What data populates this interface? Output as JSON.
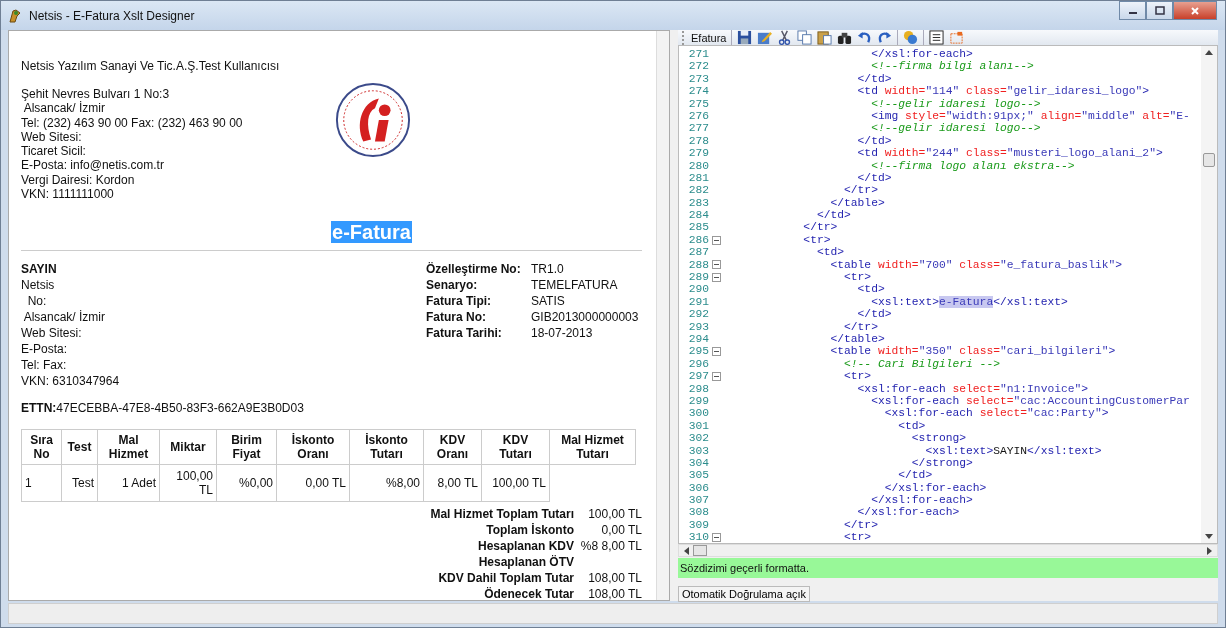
{
  "window": {
    "title": "Netsis - E-Fatura Xslt Designer"
  },
  "invoice": {
    "company_name": "Netsis Yazılım Sanayi Ve Tic.A.Ş.Test Kullanıcısı",
    "company_lines": [
      "Şehit Nevres Bulvarı 1 No:3",
      " Alsancak/ İzmir",
      "Tel: (232) 463 90 00 Fax: (232) 463 90 00",
      "Web Sitesi:",
      "Ticaret Sicil:",
      "E-Posta: info@netis.com.tr",
      "Vergi Dairesi: Kordon",
      "VKN: 1111111000"
    ],
    "title": {
      "text": "e-Fatura",
      "selected": true
    },
    "customer": {
      "heading": "SAYIN",
      "lines": [
        "Netsis",
        "  No:",
        " Alsancak/ İzmir",
        "Web Sitesi:",
        "E-Posta:",
        "Tel: Fax:",
        "VKN: 6310347964"
      ]
    },
    "details": [
      {
        "label": "Özelleştirme No:",
        "value": "TR1.0"
      },
      {
        "label": "Senaryo:",
        "value": "TEMELFATURA"
      },
      {
        "label": "Fatura Tipi:",
        "value": "SATIS"
      },
      {
        "label": "Fatura No:",
        "value": "GIB2013000000003"
      },
      {
        "label": "Fatura Tarihi:",
        "value": "18-07-2013"
      }
    ],
    "ettn": {
      "label": "ETTN:",
      "value": "47ECEBBA-47E8-4B50-83F3-662A9E3B0D03"
    },
    "table": {
      "columns": [
        "Sıra No",
        "Test",
        "Mal Hizmet",
        "Miktar",
        "Birim Fiyat",
        "İskonto Oranı",
        "İskonto Tutarı",
        "KDV Oranı",
        "KDV Tutarı",
        "Mal Hizmet Tutarı"
      ],
      "rows": [
        [
          "1",
          "Test",
          "1 Adet",
          "100,00 TL",
          "%0,00",
          "0,00 TL",
          "%8,00",
          "8,00 TL",
          "100,00 TL"
        ]
      ]
    },
    "totals": [
      {
        "label": "Mal Hizmet Toplam Tutarı",
        "value": "100,00 TL"
      },
      {
        "label": "Toplam İskonto",
        "value": "0,00 TL"
      },
      {
        "label": "Hesaplanan KDV",
        "value": "%8 8,00 TL"
      },
      {
        "label": "Hesaplanan ÖTV"
      },
      {
        "label": "KDV Dahil Toplam Tutar",
        "value": "108,00 TL"
      },
      {
        "label": "Ödenecek Tutar",
        "value": "108,00 TL"
      }
    ]
  },
  "editor": {
    "toolbar_label": "Efatura",
    "lines": [
      {
        "number": "271",
        "foldable": false,
        "tokens": [
          {
            "kind": "tag",
            "text": "                      </xsl:for-each>"
          }
        ]
      },
      {
        "number": "272",
        "foldable": false,
        "tokens": [
          {
            "kind": "comment",
            "text": "                      <!--firma bilgi alanı-->"
          }
        ]
      },
      {
        "number": "273",
        "foldable": false,
        "tokens": [
          {
            "kind": "tag",
            "text": "                    </td>"
          }
        ]
      },
      {
        "number": "274",
        "foldable": false,
        "tokens": [
          {
            "kind": "tag",
            "text": "                    <td "
          },
          {
            "kind": "attr",
            "text": "width="
          },
          {
            "kind": "value",
            "text": "\"114\" "
          },
          {
            "kind": "attr",
            "text": "class="
          },
          {
            "kind": "value",
            "text": "\"gelir_idaresi_logo\""
          },
          {
            "kind": "tag",
            "text": ">"
          }
        ]
      },
      {
        "number": "275",
        "foldable": false,
        "tokens": [
          {
            "kind": "comment",
            "text": "                      <!--gelir idaresi logo-->"
          }
        ]
      },
      {
        "number": "276",
        "foldable": false,
        "tokens": [
          {
            "kind": "tag",
            "text": "                      <img "
          },
          {
            "kind": "attr",
            "text": "style="
          },
          {
            "kind": "value",
            "text": "\"width:91px;\" "
          },
          {
            "kind": "attr",
            "text": "align="
          },
          {
            "kind": "value",
            "text": "\"middle\" "
          },
          {
            "kind": "attr",
            "text": "alt="
          },
          {
            "kind": "value",
            "text": "\"E-"
          }
        ]
      },
      {
        "number": "277",
        "foldable": false,
        "tokens": [
          {
            "kind": "comment",
            "text": "                      <!--gelir idaresi logo-->"
          }
        ]
      },
      {
        "number": "278",
        "foldable": false,
        "tokens": [
          {
            "kind": "tag",
            "text": "                    </td>"
          }
        ]
      },
      {
        "number": "279",
        "foldable": false,
        "tokens": [
          {
            "kind": "tag",
            "text": "                    <td "
          },
          {
            "kind": "attr",
            "text": "width="
          },
          {
            "kind": "value",
            "text": "\"244\" "
          },
          {
            "kind": "attr",
            "text": "class="
          },
          {
            "kind": "value",
            "text": "\"musteri_logo_alani_2\""
          },
          {
            "kind": "tag",
            "text": ">"
          }
        ]
      },
      {
        "number": "280",
        "foldable": false,
        "tokens": [
          {
            "kind": "comment",
            "text": "                      <!--firma logo alanı ekstra-->"
          }
        ]
      },
      {
        "number": "281",
        "foldable": false,
        "tokens": [
          {
            "kind": "tag",
            "text": "                    </td>"
          }
        ]
      },
      {
        "number": "282",
        "foldable": false,
        "tokens": [
          {
            "kind": "tag",
            "text": "                  </tr>"
          }
        ]
      },
      {
        "number": "283",
        "foldable": false,
        "tokens": [
          {
            "kind": "tag",
            "text": "                </table>"
          }
        ]
      },
      {
        "number": "284",
        "foldable": false,
        "tokens": [
          {
            "kind": "tag",
            "text": "              </td>"
          }
        ]
      },
      {
        "number": "285",
        "foldable": false,
        "tokens": [
          {
            "kind": "tag",
            "text": "            </tr>"
          }
        ]
      },
      {
        "number": "286",
        "foldable": true,
        "tokens": [
          {
            "kind": "tag",
            "text": "            <tr>"
          }
        ]
      },
      {
        "number": "287",
        "foldable": false,
        "tokens": [
          {
            "kind": "tag",
            "text": "              <td>"
          }
        ]
      },
      {
        "number": "288",
        "foldable": true,
        "tokens": [
          {
            "kind": "tag",
            "text": "                <table "
          },
          {
            "kind": "attr",
            "text": "width="
          },
          {
            "kind": "value",
            "text": "\"700\" "
          },
          {
            "kind": "attr",
            "text": "class="
          },
          {
            "kind": "value",
            "text": "\"e_fatura_baslik\""
          },
          {
            "kind": "tag",
            "text": ">"
          }
        ]
      },
      {
        "number": "289",
        "foldable": true,
        "tokens": [
          {
            "kind": "tag",
            "text": "                  <tr>"
          }
        ]
      },
      {
        "number": "290",
        "foldable": false,
        "tokens": [
          {
            "kind": "tag",
            "text": "                    <td>"
          }
        ]
      },
      {
        "number": "291",
        "foldable": false,
        "tokens": [
          {
            "kind": "tag",
            "text": "                      <xsl:text>"
          },
          {
            "kind": "selection",
            "text": "e-Fatura"
          },
          {
            "kind": "tag",
            "text": "</xsl:text>"
          }
        ]
      },
      {
        "number": "292",
        "foldable": false,
        "tokens": [
          {
            "kind": "tag",
            "text": "                    </td>"
          }
        ]
      },
      {
        "number": "293",
        "foldable": false,
        "tokens": [
          {
            "kind": "tag",
            "text": "                  </tr>"
          }
        ]
      },
      {
        "number": "294",
        "foldable": false,
        "tokens": [
          {
            "kind": "tag",
            "text": "                </table>"
          }
        ]
      },
      {
        "number": "295",
        "foldable": true,
        "tokens": [
          {
            "kind": "tag",
            "text": "                <table "
          },
          {
            "kind": "attr",
            "text": "width="
          },
          {
            "kind": "value",
            "text": "\"350\" "
          },
          {
            "kind": "attr",
            "text": "class="
          },
          {
            "kind": "value",
            "text": "\"cari_bilgileri\""
          },
          {
            "kind": "tag",
            "text": ">"
          }
        ]
      },
      {
        "number": "296",
        "foldable": false,
        "tokens": [
          {
            "kind": "comment",
            "text": "                  <!-- Cari Bilgileri -->"
          }
        ]
      },
      {
        "number": "297",
        "foldable": true,
        "tokens": [
          {
            "kind": "tag",
            "text": "                  <tr>"
          }
        ]
      },
      {
        "number": "298",
        "foldable": false,
        "tokens": [
          {
            "kind": "tag",
            "text": "                    <xsl:for-each "
          },
          {
            "kind": "attr",
            "text": "select="
          },
          {
            "kind": "value",
            "text": "\"n1:Invoice\""
          },
          {
            "kind": "tag",
            "text": ">"
          }
        ]
      },
      {
        "number": "299",
        "foldable": false,
        "tokens": [
          {
            "kind": "tag",
            "text": "                      <xsl:for-each "
          },
          {
            "kind": "attr",
            "text": "select="
          },
          {
            "kind": "value",
            "text": "\"cac:AccountingCustomerPar"
          }
        ]
      },
      {
        "number": "300",
        "foldable": false,
        "tokens": [
          {
            "kind": "tag",
            "text": "                        <xsl:for-each "
          },
          {
            "kind": "attr",
            "text": "select="
          },
          {
            "kind": "value",
            "text": "\"cac:Party\""
          },
          {
            "kind": "tag",
            "text": ">"
          }
        ]
      },
      {
        "number": "301",
        "foldable": false,
        "tokens": [
          {
            "kind": "tag",
            "text": "                          <td>"
          }
        ]
      },
      {
        "number": "302",
        "foldable": false,
        "tokens": [
          {
            "kind": "tag",
            "text": "                            <strong>"
          }
        ]
      },
      {
        "number": "303",
        "foldable": false,
        "tokens": [
          {
            "kind": "tag",
            "text": "                              <xsl:text>"
          },
          {
            "kind": "text",
            "text": "SAYIN"
          },
          {
            "kind": "tag",
            "text": "</xsl:text>"
          }
        ]
      },
      {
        "number": "304",
        "foldable": false,
        "tokens": [
          {
            "kind": "tag",
            "text": "                            </strong>"
          }
        ]
      },
      {
        "number": "305",
        "foldable": false,
        "tokens": [
          {
            "kind": "tag",
            "text": "                          </td>"
          }
        ]
      },
      {
        "number": "306",
        "foldable": false,
        "tokens": [
          {
            "kind": "tag",
            "text": "                        </xsl:for-each>"
          }
        ]
      },
      {
        "number": "307",
        "foldable": false,
        "tokens": [
          {
            "kind": "tag",
            "text": "                      </xsl:for-each>"
          }
        ]
      },
      {
        "number": "308",
        "foldable": false,
        "tokens": [
          {
            "kind": "tag",
            "text": "                    </xsl:for-each>"
          }
        ]
      },
      {
        "number": "309",
        "foldable": false,
        "tokens": [
          {
            "kind": "tag",
            "text": "                  </tr>"
          }
        ]
      },
      {
        "number": "310",
        "foldable": true,
        "tokens": [
          {
            "kind": "tag",
            "text": "                  <tr>"
          }
        ]
      }
    ],
    "validation_message": "Sözdizimi geçerli formatta.",
    "auto_validate_button": "Otomatik Doğrulama açık"
  }
}
